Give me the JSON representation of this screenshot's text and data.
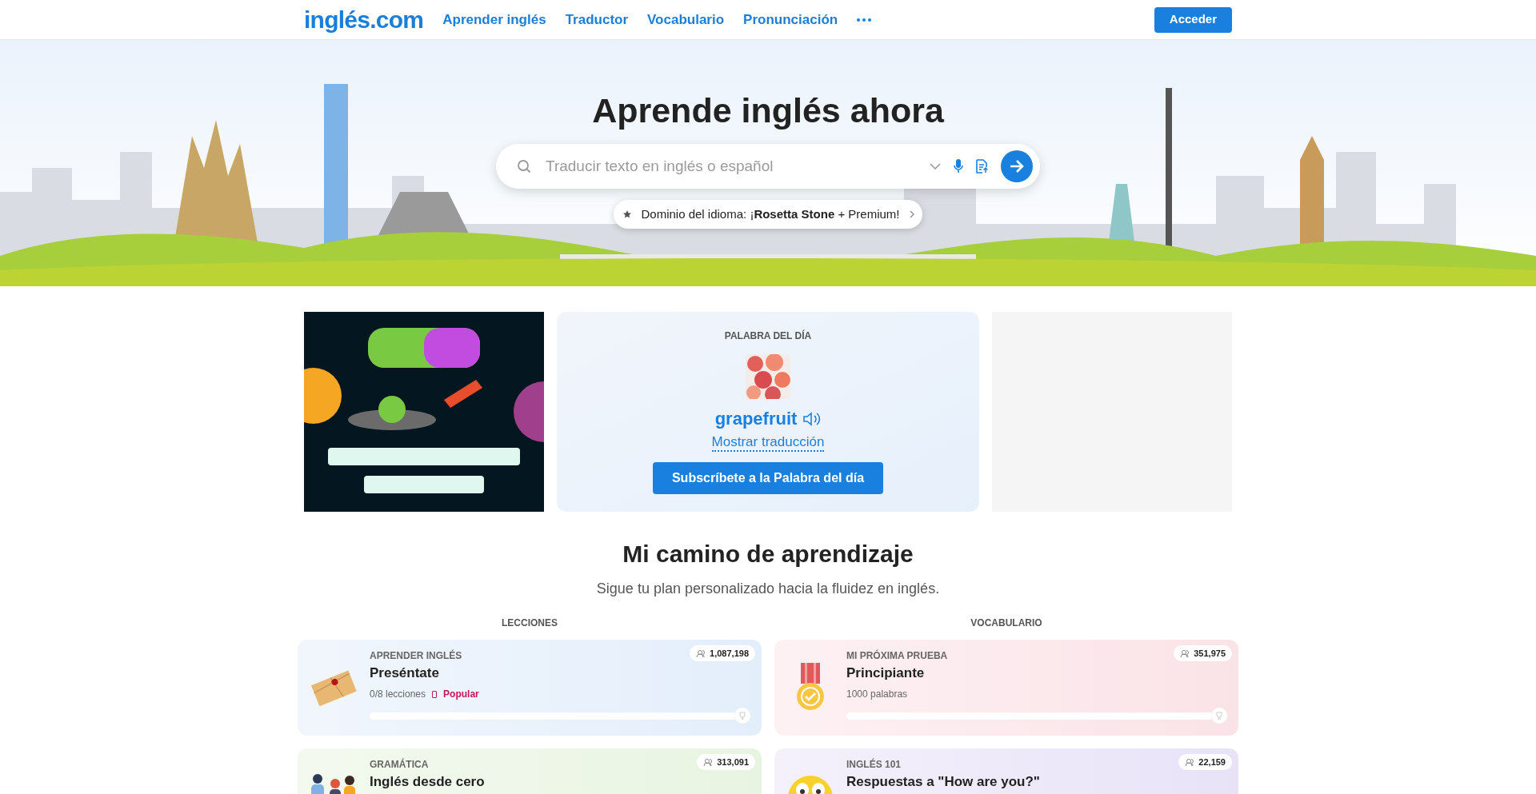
{
  "header": {
    "logo": "inglés.com",
    "nav": [
      {
        "label": "Aprender inglés"
      },
      {
        "label": "Traductor"
      },
      {
        "label": "Vocabulario"
      },
      {
        "label": "Pronunciación"
      }
    ],
    "login": "Acceder"
  },
  "hero": {
    "title": "Aprende inglés ahora",
    "search": {
      "placeholder": "Traducir texto en inglés o español"
    },
    "promo": "Dominio del idioma: ¡**Rosetta Stone** + Premium!"
  },
  "word_of_day": {
    "label": "PALABRA DEL DÍA",
    "word": "grapefruit",
    "reveal": "Mostrar traducción",
    "subscribe": "Subscríbete a la Palabra del día"
  },
  "learning": {
    "title": "Mi camino de aprendizaje",
    "subtitle": "Sigue tu plan personalizado hacia la fluidez en inglés.",
    "columns": [
      {
        "heading": "LECCIONES",
        "cards": [
          {
            "kind": "envelope",
            "category": "APRENDER INGLÉS",
            "title": "Preséntate",
            "detail": "0/8 lecciones",
            "badge": "Popular",
            "count": "1,087,198",
            "level": 0
          },
          {
            "kind": "people",
            "category": "GRAMÁTICA",
            "title": "Inglés desde cero",
            "count": "313,091"
          }
        ]
      },
      {
        "heading": "VOCABULARIO",
        "cards": [
          {
            "kind": "medal",
            "category": "MI PRÓXIMA PRUEBA",
            "title": "Principiante",
            "detail": "1000 palabras",
            "count": "351,975",
            "level": 0
          },
          {
            "kind": "emoji",
            "category": "INGLÉS 101",
            "title": "Respuestas a \"How are you?\"",
            "count": "22,159"
          }
        ]
      }
    ]
  }
}
